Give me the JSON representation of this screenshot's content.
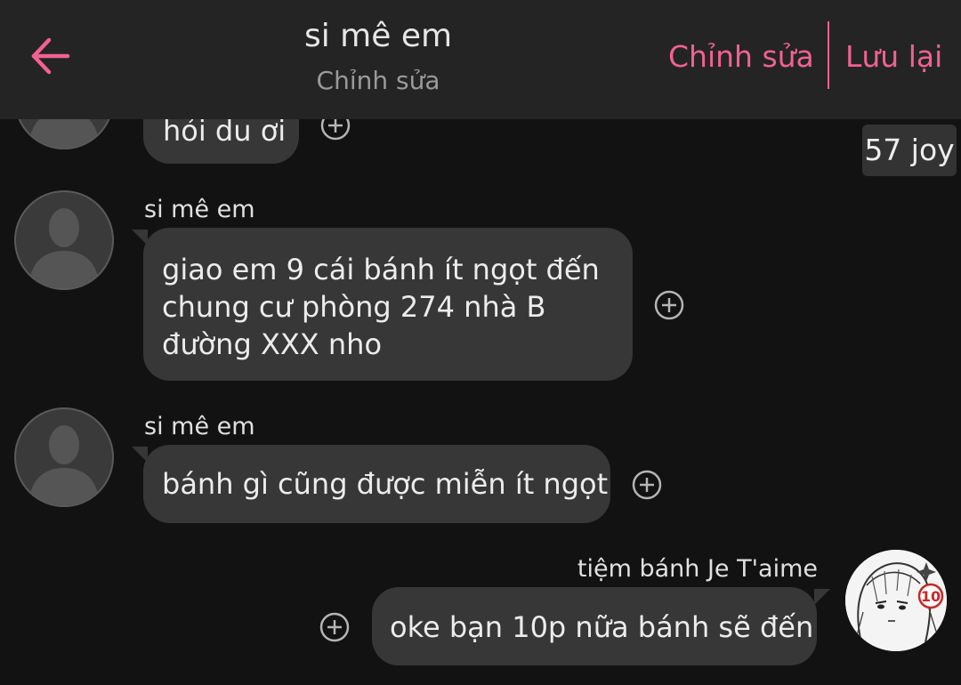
{
  "header": {
    "title": "si mê em",
    "subtitle": "Chỉnh sửa",
    "edit_label": "Chỉnh sửa",
    "save_label": "Lưu lại",
    "accent_color": "#f06292"
  },
  "icons": {
    "back": "arrow-left-icon",
    "react": "plus-circle-icon",
    "avatar": "person-silhouette-icon"
  },
  "badge": {
    "label": "57 joy"
  },
  "messages": [
    {
      "sender": "",
      "text": "hỏi du ơi",
      "partial": true
    },
    {
      "sender": "si mê em",
      "lines": [
        "giao em 9 cái bánh ít ngọt đến",
        "chung cư phòng 274 nhà B",
        "đường XXX nho"
      ]
    },
    {
      "sender": "si mê em",
      "text": "bánh gì cũng được miễn ít ngọt"
    },
    {
      "sender": "tiệm bánh Je T'aime",
      "text": "oke bạn 10p nữa bánh sẽ đến",
      "avatar_sticker": "10"
    }
  ]
}
